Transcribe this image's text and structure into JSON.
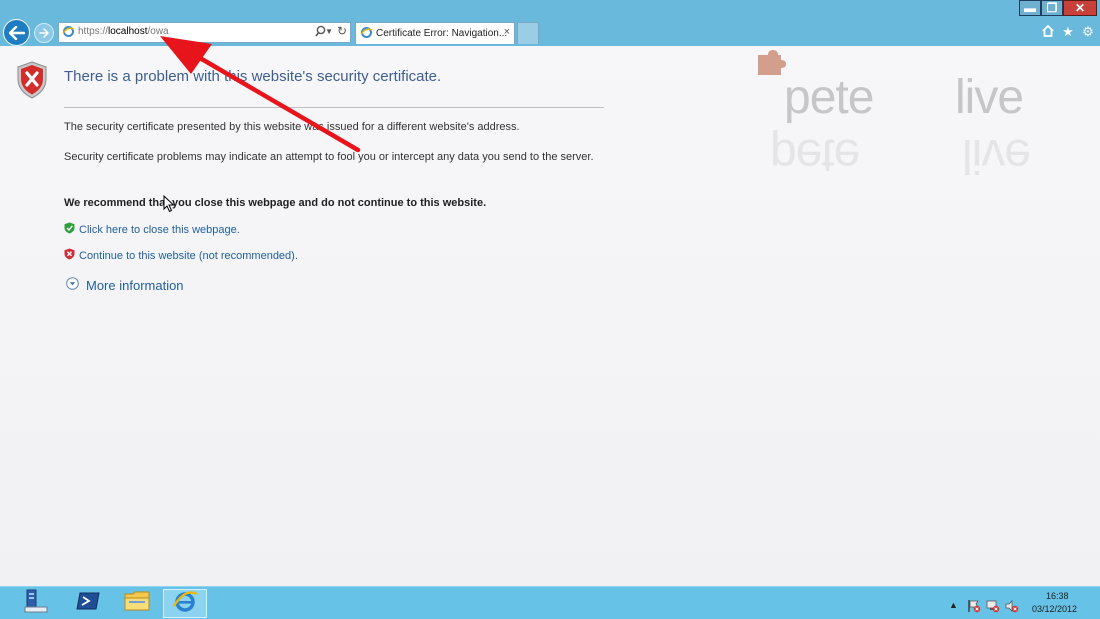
{
  "browser": {
    "address": {
      "scheme": "https://",
      "host": "localhost",
      "path": "/owa"
    },
    "tab": {
      "title": "Certificate Error: Navigation...",
      "close_glyph": "×"
    },
    "toolbar_icons": [
      "home-icon",
      "star-icon",
      "gear-icon"
    ],
    "window_buttons": {
      "minimize": "▬",
      "restore": "❐",
      "close": "✕"
    }
  },
  "page": {
    "title": "There is a problem with this website's security certificate.",
    "message_1": "The security certificate presented by this website was issued for a different website's address.",
    "message_2": "Security certificate problems may indicate an attempt to fool you or intercept any data you send to the server.",
    "recommendation": "We recommend that you close this webpage and do not continue to this website.",
    "close_link": "Click here to close this webpage.",
    "continue_link": "Continue to this website (not recommended).",
    "more_info": "More information"
  },
  "watermark": {
    "word_1": "pete",
    "word_2": "live"
  },
  "annotation": {
    "arrow_color": "#e8141b"
  },
  "taskbar": {
    "buttons": [
      "server-manager-icon",
      "powershell-icon",
      "file-explorer-icon",
      "internet-explorer-icon"
    ],
    "clock": {
      "time": "16:38",
      "date": "03/12/2012"
    }
  },
  "colors": {
    "chrome": "#69b9dd",
    "taskbar": "#67c2e7",
    "title_text": "#3e5e8f",
    "link": "#1f5f9e"
  }
}
